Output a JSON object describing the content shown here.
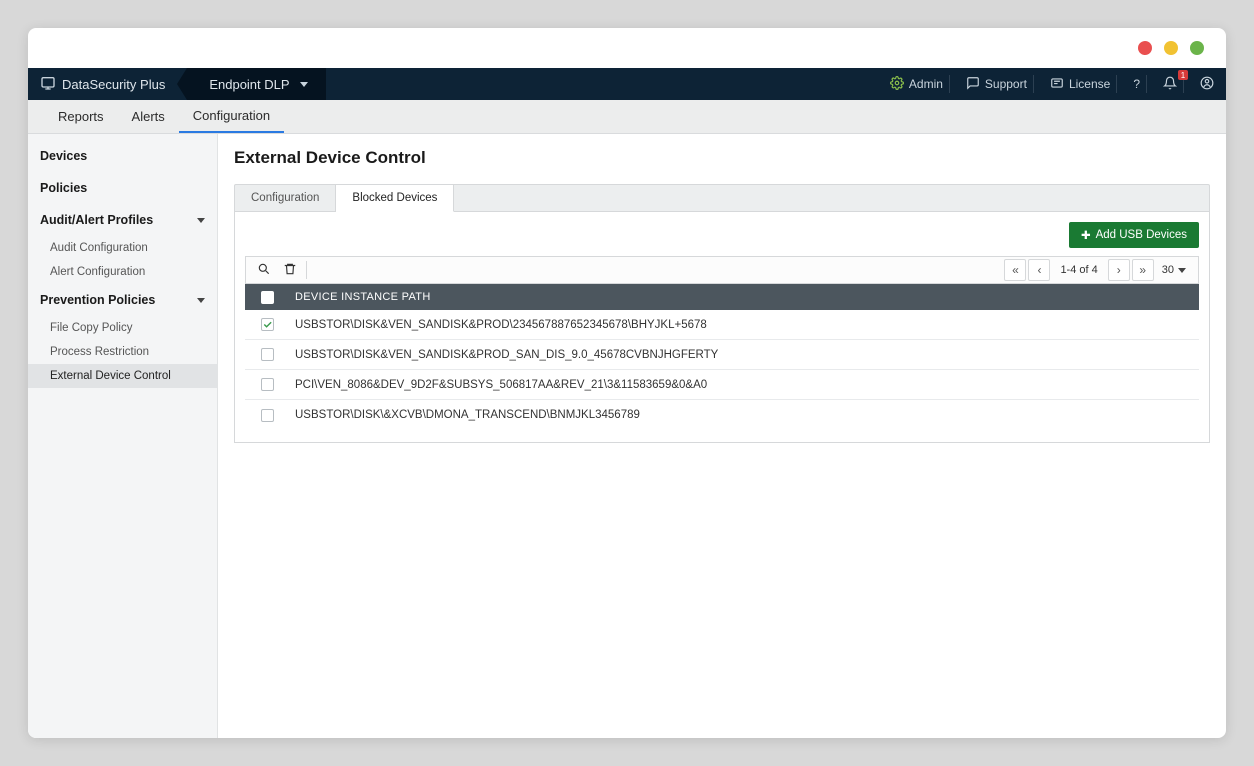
{
  "brand": "DataSecurity Plus",
  "module": "Endpoint DLP",
  "topbar": {
    "admin": "Admin",
    "support": "Support",
    "license": "License",
    "help": "?",
    "notif_count": "1"
  },
  "tabs": {
    "reports": "Reports",
    "alerts": "Alerts",
    "config": "Configuration"
  },
  "sidebar": {
    "devices": "Devices",
    "policies": "Policies",
    "audit_alert": "Audit/Alert Profiles",
    "audit_config": "Audit Configuration",
    "alert_config": "Alert Configuration",
    "prevention": "Prevention Policies",
    "file_copy": "File Copy Policy",
    "process": "Process Restriction",
    "ext_device": "External Device Control"
  },
  "page": {
    "title": "External Device Control",
    "subtab_config": "Configuration",
    "subtab_blocked": "Blocked Devices",
    "add_btn": "Add USB Devices",
    "col_header": "DEVICE INSTANCE PATH",
    "page_info": "1-4 of 4",
    "page_size": "30",
    "rows": [
      {
        "checked": true,
        "path": "USBSTOR\\DISK&VEN_SANDISK&PROD\\234567887652345678\\BHYJKL+5678"
      },
      {
        "checked": false,
        "path": "USBSTOR\\DISK&VEN_SANDISK&PROD_SAN_DIS_9.0_45678CVBNJHGFERTY"
      },
      {
        "checked": false,
        "path": "PCI\\VEN_8086&DEV_9D2F&SUBSYS_506817AA&REV_21\\3&11583659&0&A0"
      },
      {
        "checked": false,
        "path": "USBSTOR\\DISK\\&XCVB\\DMONA_TRANSCEND\\BNMJKL3456789"
      }
    ]
  }
}
